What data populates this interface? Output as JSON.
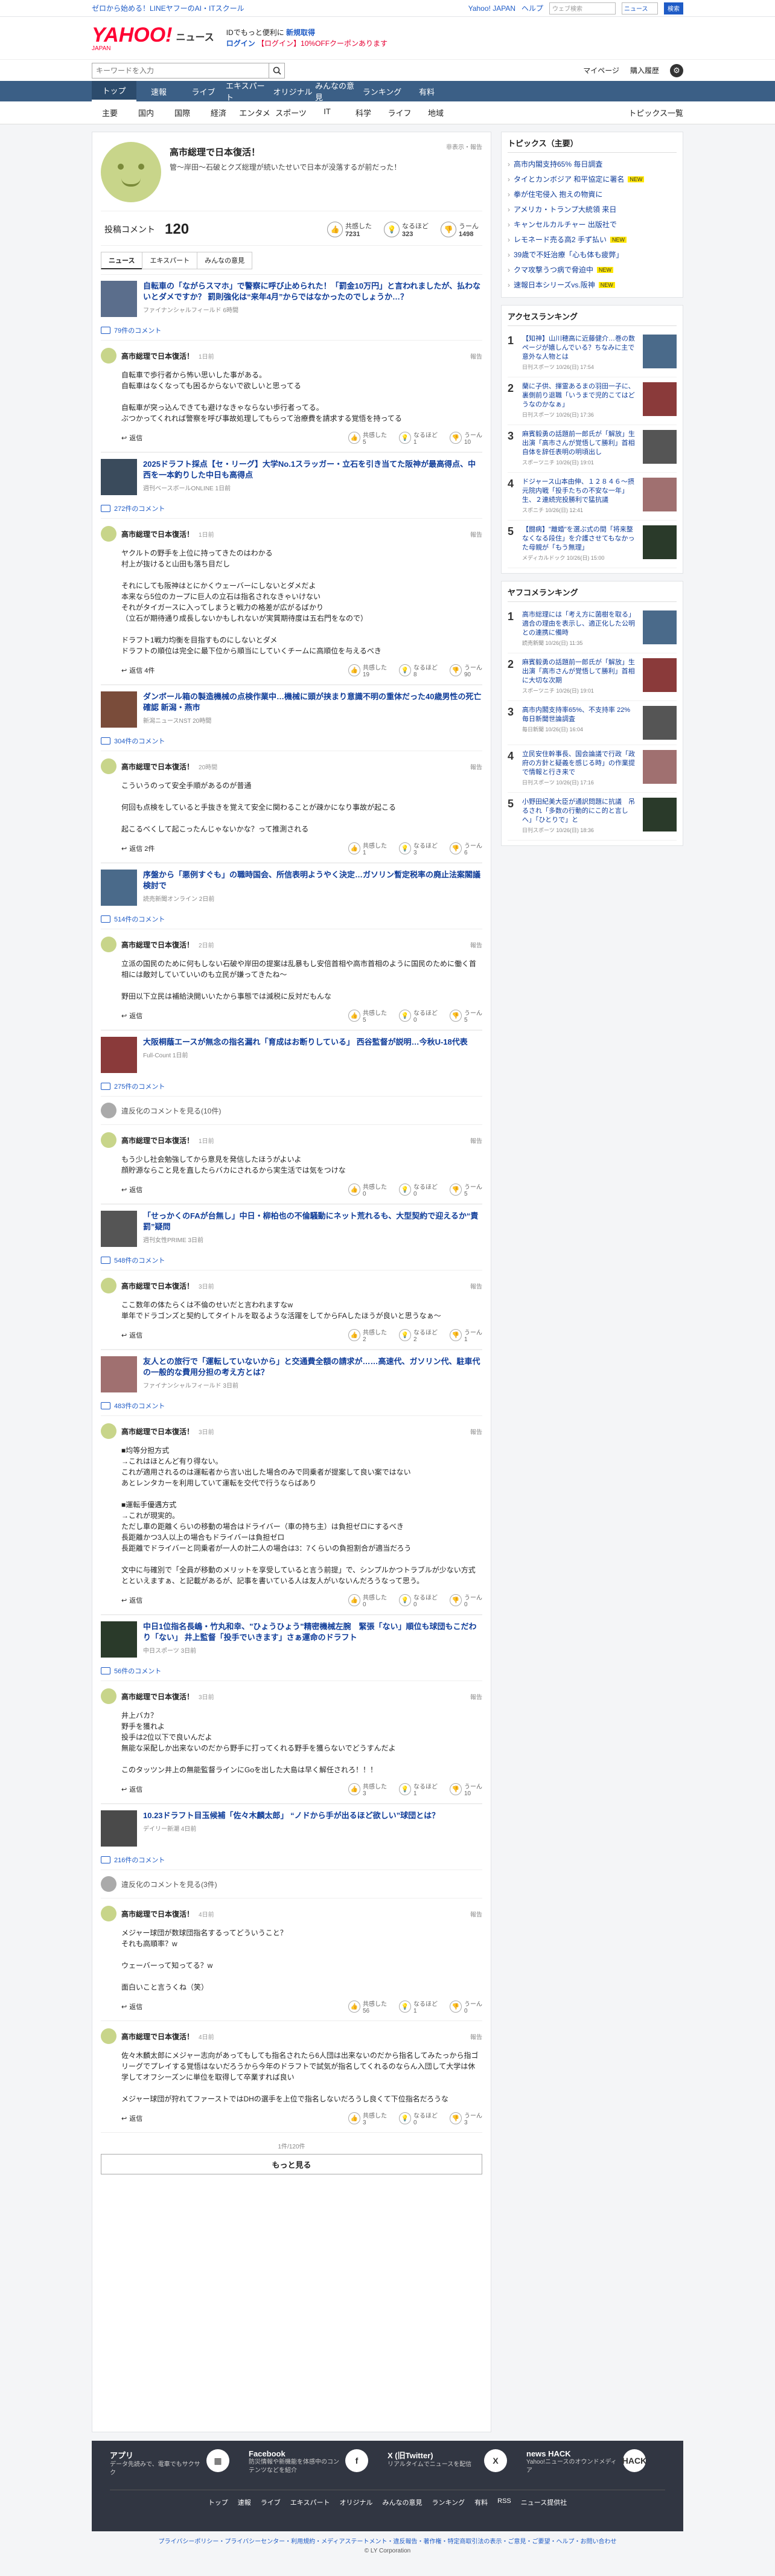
{
  "topstrip": {
    "promo": "ゼロから始める！LINEヤフーのAI・ITスクール",
    "yahoo": "Yahoo! JAPAN",
    "help": "ヘルプ",
    "search_ph": "ウェブ検索",
    "sel": "ニュース",
    "btn": "検索"
  },
  "header": {
    "logo": "YAHOO!",
    "logo_jp": "JAPAN",
    "section": "ニュース",
    "promo1a": "IDでもっと便利に",
    "promo1b": "新規取得",
    "promo2a": "ログイン",
    "promo2b": "【ログイン】10%OFFクーポンあります"
  },
  "search": {
    "placeholder": "キーワードを入力",
    "mypage": "マイページ",
    "buy": "購入履歴"
  },
  "gnav": [
    "トップ",
    "速報",
    "ライブ",
    "エキスパート",
    "オリジナル",
    "みんなの意見",
    "ランキング",
    "有料"
  ],
  "snav": {
    "items": [
      "主要",
      "国内",
      "国際",
      "経済",
      "エンタメ",
      "スポーツ",
      "IT",
      "科学",
      "ライフ",
      "地域"
    ],
    "topics": "トピックス一覧"
  },
  "article": {
    "title": "高市総理で日本復活！",
    "sub": "管〜岸田〜石破とクズ総理が続いたせいで日本が没落するが前だった！",
    "src": "非表示・報告"
  },
  "cbar": {
    "label": "投稿コメント",
    "count": "120",
    "r1l": "共感した",
    "r1": "7231",
    "r2l": "なるほど",
    "r2": "323",
    "r3l": "うーん",
    "r3": "1498"
  },
  "tabs": [
    "ニュース",
    "エキスパート",
    "みんなの意見"
  ],
  "threads": [
    {
      "title": "自転車の「ながらスマホ」で警察に呼び止められた！「罰金10万円」と言われましたが、払わないとダメですか？ 罰則強化は“来年4月”からではなかったのでしょうか…？",
      "meta": "ファイナンシャルフィールド 6時間",
      "cc": "79件のコメント",
      "comments": [
        {
          "name": "高市総理で日本復活！",
          "time": "1日前",
          "body": "自転車で歩行者から怖い思いした事がある。\n自転車はなくなっても困るからないで欲しいと思ってる\n\n自転車が突っ込んできても避けなきゃならない歩行者ってる。\nぶつかってくれれば警察を呼び事故処理してもらって治療費を請求する覚悟を持ってる",
          "rep": "返信",
          "a": "5",
          "b": "1",
          "c": "10"
        }
      ]
    },
    {
      "title": "2025ドラフト採点【セ・リーグ】大学No.1スラッガー・立石を引き当てた阪神が最高得点、中西を一本釣りした中日も高得点",
      "meta": "週刊ベースボールONLINE 1日前",
      "cc": "272件のコメント",
      "comments": [
        {
          "name": "高市総理で日本復活！",
          "time": "1日前",
          "body": "ヤクルトの野手を上位に持ってきたのはわかる\n村上が抜けると山田も落ち目だし\n\nそれにしても阪神はとにかくウェーバーにしないとダメだよ\n本来なら5位のカープに巨人の立石は指名されなきゃいけない\nそれがタイガースに入ってしまうと戦力の格差が広がるばかり\n（立石が期待通り成長しないかもしれないが実質期待度は五右門をなので）\n\nドラフト1戦力均衡を目指すものにしないとダメ\nドラフトの順位は完全に最下位から順当にしていくチームに高順位を与えるべき",
          "rep": "返信 4件",
          "a": "19",
          "b": "8",
          "c": "90"
        }
      ]
    },
    {
      "title": "ダンボール箱の製造機械の点検作業中…機械に頭が挟まり意識不明の重体だった40歳男性の死亡確認 新潟・燕市",
      "meta": "新潟ニュースNST 20時間",
      "cc": "304件のコメント",
      "comments": [
        {
          "name": "高市総理で日本復活！",
          "time": "20時間",
          "body": "こういうのって安全手順があるのが普通\n\n何回も点検をしていると手抜きを覚えて安全に関わることが疎かになり事故が起こる\n\n起こるべくして起こったんじゃないかな？って推測される",
          "rep": "返信 2件",
          "a": "1",
          "b": "3",
          "c": "6"
        }
      ]
    },
    {
      "title": "序盤から「悪例すぐも」の職時国会、所信表明ようやく決定…ガソリン暫定税率の廃止法案閣議検討で",
      "meta": "読売新聞オンライン 2日前",
      "cc": "514件のコメント",
      "comments": [
        {
          "name": "高市総理で日本復活！",
          "time": "2日前",
          "body": "立派の国民のために何もしない石破や岸田の提案は乱暴もし安倍首相や高市首相のように国民のために働く首相には敵対していていいのも立民が嫌ってきたね〜\n\n野田以下立民は補給決開いいたから事態では減税に反対だもんな",
          "rep": "返信",
          "a": "5",
          "b": "0",
          "c": "5"
        }
      ]
    },
    {
      "title": "大阪桐蔭エースが無念の指名漏れ「育成はお断りしている」 西谷監督が説明…今秋U-18代表",
      "meta": "Full-Count 1日前",
      "cc": "275件のコメント",
      "hidden": "違反化のコメントを見る(10件)",
      "comments": [
        {
          "name": "高市総理で日本復活！",
          "time": "1日前",
          "body": "もう少し社会勉強してから意見を発信したほうがよいよ\n顔貯源ならこと見を直したらバカにされるから実生活では気をつけな",
          "rep": "返信",
          "a": "0",
          "b": "0",
          "c": "5"
        }
      ]
    },
    {
      "title": "「せっかくのFAが台無し」中日・柳柏也の不倫騒動にネット荒れるも、大型契約で迎えるか“責罰”疑問",
      "meta": "週刊女性PRIME 3日前",
      "cc": "548件のコメント",
      "comments": [
        {
          "name": "高市総理で日本復活！",
          "time": "3日前",
          "body": "ここ数年の体たらくは不倫のせいだと言われますなw\n単年でドラゴンズと契約してタイトルを取るような活躍をしてからFAしたほうが良いと思うなぁ〜",
          "rep": "返信",
          "a": "2",
          "b": "2",
          "c": "1"
        }
      ]
    },
    {
      "title": "友人との旅行で「運転していないから」と交通費全額の請求が……高速代、ガソリン代、駐車代の一般的な費用分担の考え方とは？",
      "meta": "ファイナンシャルフィールド 3日前",
      "cc": "483件のコメント",
      "comments": [
        {
          "name": "高市総理で日本復活！",
          "time": "3日前",
          "body": "■均等分担方式\n→これはほとんど有り得ない。\nこれが適用されるのは運転者から言い出した場合のみで同乗者が提案して良い案ではない\nあとレンタカーを利用していて運転を交代で行うならばあり\n\n■運転手優遇方式\n→これが現実的。\nただし車の距離くらいの移動の場合はドライバー（車の持ち主）は負担ゼロにするべき\n長距離かつ3人以上の場合もドライバーは負担ゼロ\n長距離でドライバーと同乗者が一人の計二人の場合は3：7くらいの負担割合が適当だろう\n\n文中に与確別で「全員が移動のメリットを享受していると言う前提」で、シンプルかつトラブルが少ない方式とといえますぁ、と記載があるが、記事を書いている人は友人がいないんだろうなって思う。",
          "rep": "返信",
          "a": "0",
          "b": "0",
          "c": "0"
        }
      ]
    },
    {
      "title": "中日1位指名長嶋・竹丸和幸、\"ひょうひょう\"精密機械左腕　緊張「ない」順位も球団もこだわり「ない」 井上監督「投手でいきます」さぁ運命のドラフト",
      "meta": "中日スポーツ 3日前",
      "cc": "56件のコメント",
      "comments": [
        {
          "name": "高市総理で日本復活！",
          "time": "3日前",
          "body": "井上バカ？\n野手を獲れよ\n投手は2位以下で良いんだよ\n無能な采配しか出来ないのだから野手に打ってくれる野手を獲らないでどうすんだよ\n\nこのタッツン井上の無能監督ラインにGoを出した大島は早く解任されろ！！！",
          "rep": "返信",
          "a": "3",
          "b": "1",
          "c": "10"
        }
      ]
    },
    {
      "title": "10.23ドラフト目玉候補「佐々木麟太郎」 “ノドから手が出るほど欲しい”球団とは？",
      "meta": "デイリー新潮 4日前",
      "cc": "216件のコメント",
      "hidden": "違反化のコメントを見る(3件)",
      "comments": [
        {
          "name": "高市総理で日本復活！",
          "time": "4日前",
          "body": "メジャー球団が数球団指名するってどういうこと？\nそれも高順率？w\n\nウェーバーって知ってる？w\n\n面白いこと言うくね（笑）",
          "rep": "返信",
          "a": "56",
          "b": "1",
          "c": "0"
        },
        {
          "name": "高市総理で日本復活！",
          "time": "4日前",
          "body": "佐々木麟太郎にメジャー志向があってもしても指名されたら6人団は出来ないのだから指名してみたっから指ゴリーグでプレイする覚悟はないだろうから今年のドラフトで試気が指名してくれるのならん入団して大学は休学してオフシーズンに単位を取得して卒業すれば良い\n\nメジャー球団が狩れてファーストではDHの選手を上位で指名しないだろうし良くて下位指名だろうな",
          "rep": "返信",
          "a": "3",
          "b": "0",
          "c": "3"
        }
      ]
    }
  ],
  "more": {
    "pg": "1件/120件",
    "btn": "もっと見る"
  },
  "side": {
    "topics_title": "トピックス（主要）",
    "topics": [
      {
        "t": "高市内閣支持65% 毎日調査",
        "n": false
      },
      {
        "t": "タイとカンボジア 和平協定に署名",
        "n": true
      },
      {
        "t": "拳が住宅侵入 抱えの物資に",
        "n": false
      },
      {
        "t": "アメリカ・トランプ大統領 来日",
        "n": false
      },
      {
        "t": "キャンセルカルチャー 出版社で",
        "n": false
      },
      {
        "t": "レモネード売る高2 手ず払い",
        "n": true
      },
      {
        "t": "39歳で不妊治療「心も体も疲弊」",
        "n": false
      },
      {
        "t": "クマ攻撃うつ病で脅迫中",
        "n": true
      },
      {
        "t": "速報日本シリーズvs.阪神",
        "n": true
      }
    ],
    "access_title": "アクセスランキング",
    "access": [
      {
        "t": "【知神】山川穂高に近藤健介…巻の数ページが嬉しんでいる？ちなみに主で意外な人物とは",
        "s": "日刊スポーツ 10/26(日) 17:54"
      },
      {
        "t": "蘭に子供、揮霊あるまの羽田一子に、裏側前り退職「いうまで児的こてはどうなのかなぁ」",
        "s": "日刊スポーツ 10/26(日) 17:36"
      },
      {
        "t": "麻賓毅勇の話題前一郎氏が「解放」生出演「高市さんが覚悟して勝利」首相自体を辞任表明の明頃出し",
        "s": "スポーツニチ 10/26(日) 19:01"
      },
      {
        "t": "ドジャース山本由伸、１２８４６〜摂元院内戦「投手たちの不安な一年」生、２連続完投勝利で猛抗議",
        "s": "スポニチ 10/26(日) 12:41"
      },
      {
        "t": "【闘病】\"離婚\"を選ぶ式の間「将来整なくなる段住」を介護させてもなかった母親が「もう無理」",
        "s": "メディカルドック 10/26(日) 15:00"
      }
    ],
    "yahoo_title": "ヤフコメランキング",
    "yahoo": [
      {
        "t": "高市総理には「考え方に菌樹を取る」適合の理由を表示し、適正化した公明との連携に備時",
        "s": "読売新聞 10/26(日) 11:35"
      },
      {
        "t": "麻賓毅勇の話題前一郎氏が「解放」生出演「高市さんが覚悟して勝利」首相に大切な次期",
        "s": "スポーツニチ 10/26(日) 19:01"
      },
      {
        "t": "高市内閣支持率65%、不支持率 22% 毎日新聞世論調査",
        "s": "毎日新聞 10/26(日) 16:04"
      },
      {
        "t": "立民安住幹事長、国会論議で行政「政府の方針と疑義を感じる時」の作業提で情報と行き来で",
        "s": "日刊スポーツ 10/26(日) 17:16"
      },
      {
        "t": "小野田紀美大臣が通訳問題に抗議　吊るされ「多数の行動的にこ的と言しへ」「ひとりで」と",
        "s": "日刊スポーツ 10/26(日) 18:36"
      }
    ]
  },
  "footer": {
    "cols": [
      {
        "t": "アプリ",
        "d": "データ先読みで、電車でもサクサク",
        "i": "▦"
      },
      {
        "t": "Facebook",
        "d": "防災情報や新機能を体感中のコンテンツなどを紹介",
        "i": "f"
      },
      {
        "t": "X (旧Twitter)",
        "d": "リアルタイムでニュースを配信",
        "i": "X"
      },
      {
        "t": "news HACK",
        "d": "Yahoo!ニュースのオウンドメディア",
        "i": "HACK"
      }
    ],
    "links": [
      "トップ",
      "速報",
      "ライブ",
      "エキスパート",
      "オリジナル",
      "みんなの意見",
      "ランキング",
      "有料",
      "RSS",
      "ニュース提供社"
    ],
    "bottom": "プライバシーポリシー・プライバシーセンター・利用規約・メディアステートメント・違反報告・著作権・特定商取引法の表示・ご意見・ご要望・ヘルプ・お問い合わせ",
    "copy": "© LY Corporation"
  }
}
